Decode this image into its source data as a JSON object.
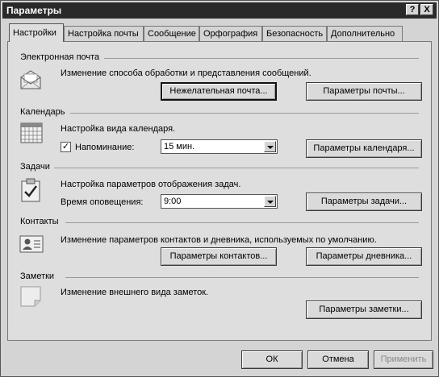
{
  "window": {
    "title": "Параметры",
    "help_label": "?",
    "close_label": "X"
  },
  "tabs": [
    {
      "label": "Настройки",
      "active": true
    },
    {
      "label": "Настройка почты"
    },
    {
      "label": "Сообщение"
    },
    {
      "label": "Орфография"
    },
    {
      "label": "Безопасность"
    },
    {
      "label": "Дополнительно"
    }
  ],
  "email": {
    "title": "Электронная почта",
    "desc": "Изменение способа обработки и представления сообщений.",
    "junk_button": "Нежелательная почта...",
    "mail_options_button": "Параметры почты..."
  },
  "calendar": {
    "title": "Календарь",
    "desc": "Настройка вида календаря.",
    "reminder_checked": "✓",
    "reminder_label": "Напоминание:",
    "reminder_value": "15 мин.",
    "options_button": "Параметры календаря..."
  },
  "tasks": {
    "title": "Задачи",
    "desc": "Настройка параметров отображения задач.",
    "reminder_time_label": "Время оповещения:",
    "reminder_time_value": "9:00",
    "options_button": "Параметры задачи..."
  },
  "contacts": {
    "title": "Контакты",
    "desc": "Изменение параметров контактов и дневника, используемых  по умолчанию.",
    "contact_options_button": "Параметры контактов...",
    "journal_options_button": "Параметры дневника..."
  },
  "notes": {
    "title": "Заметки",
    "desc": "Изменение внешнего вида заметок.",
    "options_button": "Параметры заметки..."
  },
  "footer": {
    "ok": "ОК",
    "cancel": "Отмена",
    "apply": "Применить"
  }
}
